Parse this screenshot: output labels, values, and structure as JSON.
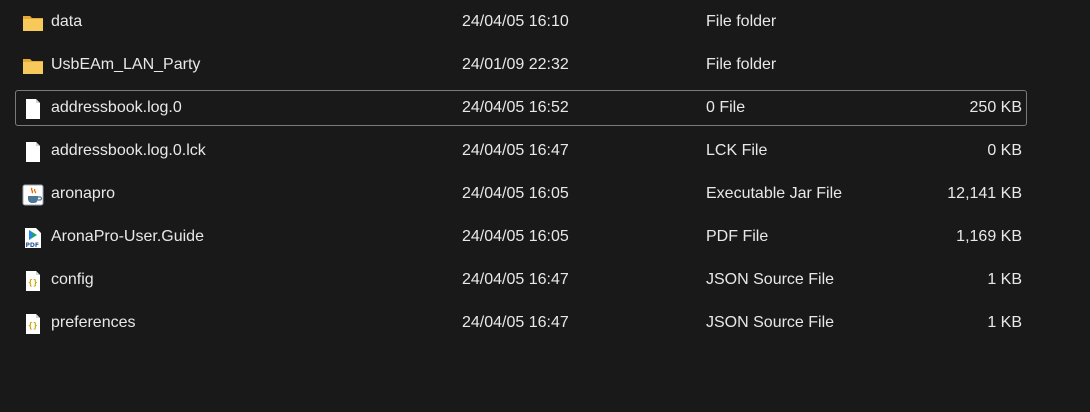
{
  "files": [
    {
      "name": "data",
      "date": "24/04/05 16:10",
      "type": "File folder",
      "size": "",
      "icon": "folder-icon",
      "selected": false
    },
    {
      "name": "UsbEAm_LAN_Party",
      "date": "24/01/09 22:32",
      "type": "File folder",
      "size": "",
      "icon": "folder-icon",
      "selected": false
    },
    {
      "name": "addressbook.log.0",
      "date": "24/04/05 16:52",
      "type": "0 File",
      "size": "250 KB",
      "icon": "document-icon",
      "selected": true
    },
    {
      "name": "addressbook.log.0.lck",
      "date": "24/04/05 16:47",
      "type": "LCK File",
      "size": "0 KB",
      "icon": "document-icon",
      "selected": false
    },
    {
      "name": "aronapro",
      "date": "24/04/05 16:05",
      "type": "Executable Jar File",
      "size": "12,141 KB",
      "icon": "java-jar-icon",
      "selected": false
    },
    {
      "name": "AronaPro-User.Guide",
      "date": "24/04/05 16:05",
      "type": "PDF File",
      "size": "1,169 KB",
      "icon": "pdf-icon",
      "selected": false
    },
    {
      "name": "config",
      "date": "24/04/05 16:47",
      "type": "JSON Source File",
      "size": "1 KB",
      "icon": "json-file-icon",
      "selected": false
    },
    {
      "name": "preferences",
      "date": "24/04/05 16:47",
      "type": "JSON Source File",
      "size": "1 KB",
      "icon": "json-file-icon",
      "selected": false
    }
  ],
  "colors": {
    "background": "#191919",
    "text": "#e8e8e8",
    "folder": "#f2c04a",
    "selection_border": "#7a7a7a"
  }
}
